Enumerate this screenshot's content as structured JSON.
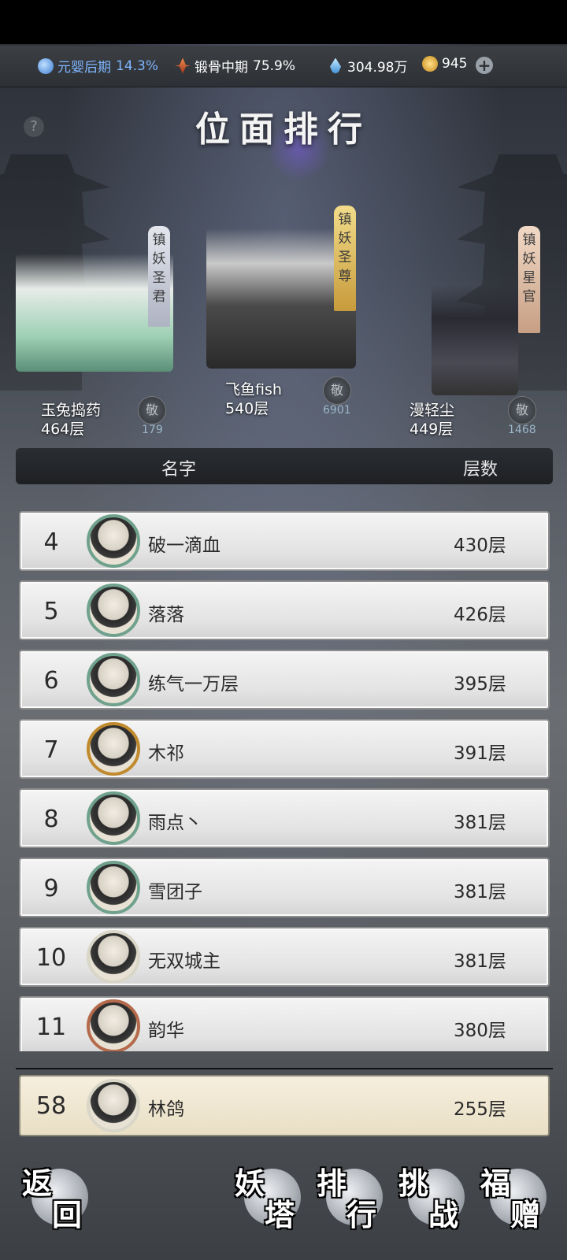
{
  "status": {
    "realm_label": "元婴后期",
    "realm_pct": "14.3%",
    "body_label": "锻骨中期",
    "body_pct": "75.9%",
    "spirit_value": "304.98万",
    "coin_value": "945"
  },
  "page_title": "位面排行",
  "podium": [
    {
      "place": 2,
      "name": "玉兔捣药",
      "floor": "464层",
      "title_chars": [
        "镇",
        "妖",
        "圣",
        "君"
      ],
      "likes": "179"
    },
    {
      "place": 1,
      "name": "飞鱼fish",
      "floor": "540层",
      "title_chars": [
        "镇",
        "妖",
        "圣",
        "尊"
      ],
      "likes": "6901"
    },
    {
      "place": 3,
      "name": "漫轻尘",
      "floor": "449层",
      "title_chars": [
        "镇",
        "妖",
        "星",
        "官"
      ],
      "likes": "1468"
    }
  ],
  "like_icon_char": "敬",
  "table_header": {
    "name": "名字",
    "floor": "层数"
  },
  "rows": [
    {
      "rank": "4",
      "name": "破一滴血",
      "floor": "430层"
    },
    {
      "rank": "5",
      "name": "落落",
      "floor": "426层"
    },
    {
      "rank": "6",
      "name": "练气一万层",
      "floor": "395层"
    },
    {
      "rank": "7",
      "name": "木祁",
      "floor": "391层"
    },
    {
      "rank": "8",
      "name": "雨点丶",
      "floor": "381层"
    },
    {
      "rank": "9",
      "name": "雪团子",
      "floor": "381层"
    },
    {
      "rank": "10",
      "name": "无双城主",
      "floor": "381层"
    },
    {
      "rank": "11",
      "name": "韵华",
      "floor": "380层"
    }
  ],
  "my_rank": {
    "rank": "58",
    "name": "林鸽",
    "floor": "255层"
  },
  "nav": {
    "back": [
      "返",
      "回"
    ],
    "tower": [
      "妖",
      "塔"
    ],
    "ranking": [
      "排",
      "行"
    ],
    "challenge": [
      "挑",
      "战"
    ],
    "gift": [
      "福",
      "赠"
    ]
  },
  "colors": {
    "realm": "#7fb6ff",
    "gold_banner": "#d8b860",
    "silver_banner": "#c9cbd4",
    "bronze_banner": "#d7b7a0"
  }
}
